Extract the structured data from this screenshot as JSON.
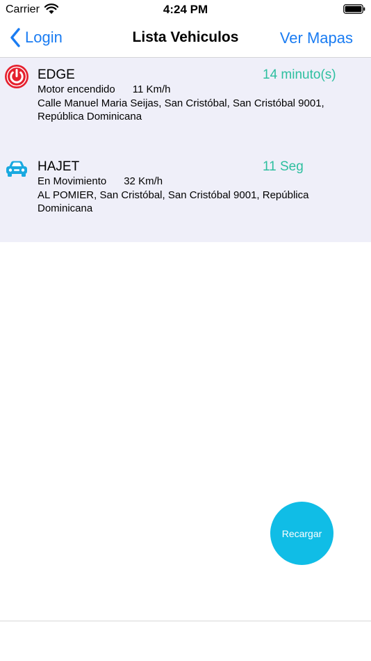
{
  "status_bar": {
    "carrier": "Carrier",
    "time": "4:24 PM"
  },
  "nav": {
    "back_label": "Login",
    "title": "Lista Vehiculos",
    "right_label": "Ver Mapas"
  },
  "vehicles": [
    {
      "name": "EDGE",
      "time": "14 minuto(s)",
      "status": "Motor encendido      11 Km/h",
      "address": "Calle Manuel Maria Seijas, San Cristóbal, San Cristóbal 9001, República Dominicana",
      "icon": "power-icon",
      "icon_color": "#e5202e"
    },
    {
      "name": "HAJET",
      "time": "11 Seg",
      "status": "En Movimiento      32 Km/h",
      "address": "AL  POMIER, San Cristóbal, San Cristóbal 9001, República Dominicana",
      "icon": "car-icon",
      "icon_color": "#19a9e0"
    }
  ],
  "reload_label": "Recargar",
  "colors": {
    "accent": "#1a7cf2",
    "time_text": "#2dbf9f",
    "list_background": "#efeff9",
    "reload_button": "#10bde6"
  }
}
